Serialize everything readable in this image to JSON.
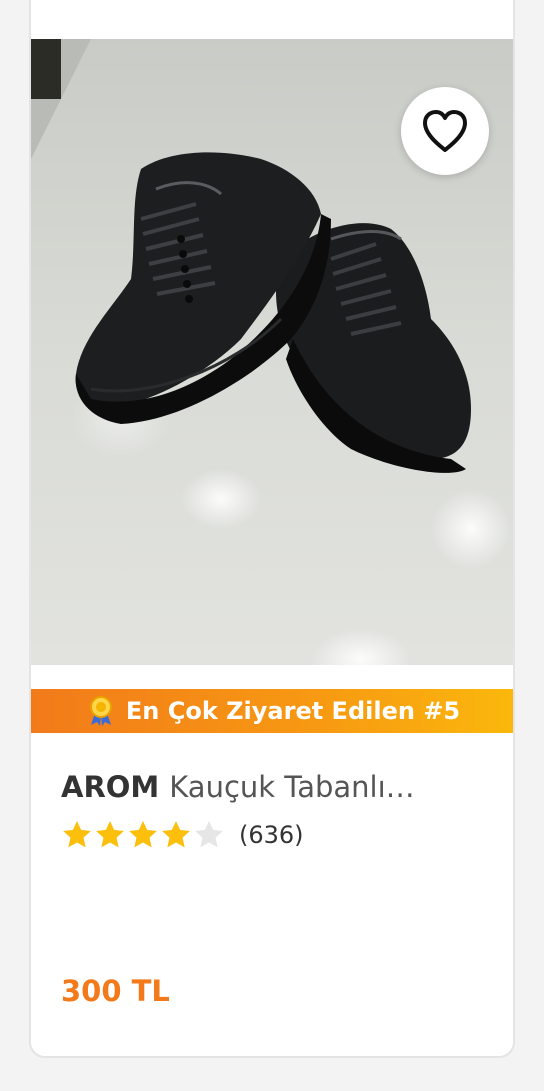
{
  "product": {
    "brand": "AROM",
    "name": "Kauçuk Tabanlı…",
    "rating": 4,
    "rating_max": 5,
    "review_count": "(636)",
    "price": "300 TL"
  },
  "badge": {
    "label": "En Çok Ziyaret Edilen #5",
    "icon": "award-ribbon-icon"
  },
  "favorite": {
    "icon": "heart-icon"
  },
  "colors": {
    "accent": "#f27a1a",
    "star": "#fbbf0c",
    "star_empty": "#e6e6e6"
  }
}
